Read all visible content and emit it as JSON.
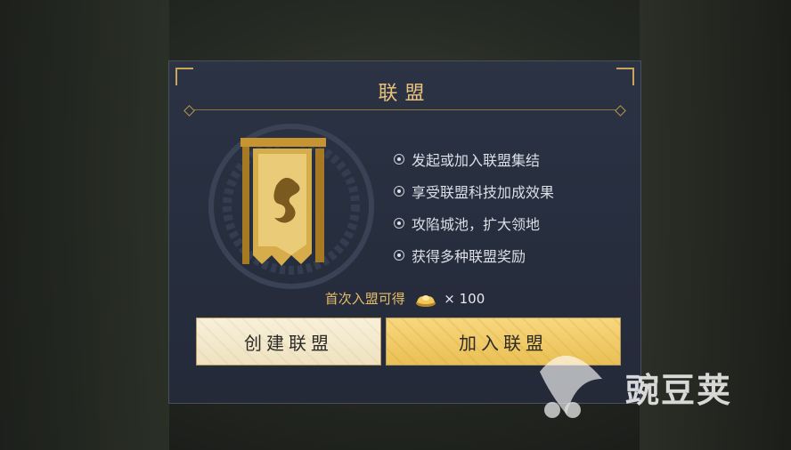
{
  "dialog": {
    "title": "联盟",
    "features": [
      "发起或加入联盟集结",
      "享受联盟科技加成效果",
      "攻陷城池，扩大领地",
      "获得多种联盟奖励"
    ],
    "reward_label": "首次入盟可得",
    "reward_amount": "× 100",
    "create_button_label": "创建联盟",
    "join_button_label": "加入联盟"
  },
  "watermark": {
    "text": "豌豆荚"
  },
  "colors": {
    "gold": "#e7c27a",
    "panel": "#2b3344",
    "join_button": "#f3cd69",
    "create_button": "#f6ecd1"
  }
}
